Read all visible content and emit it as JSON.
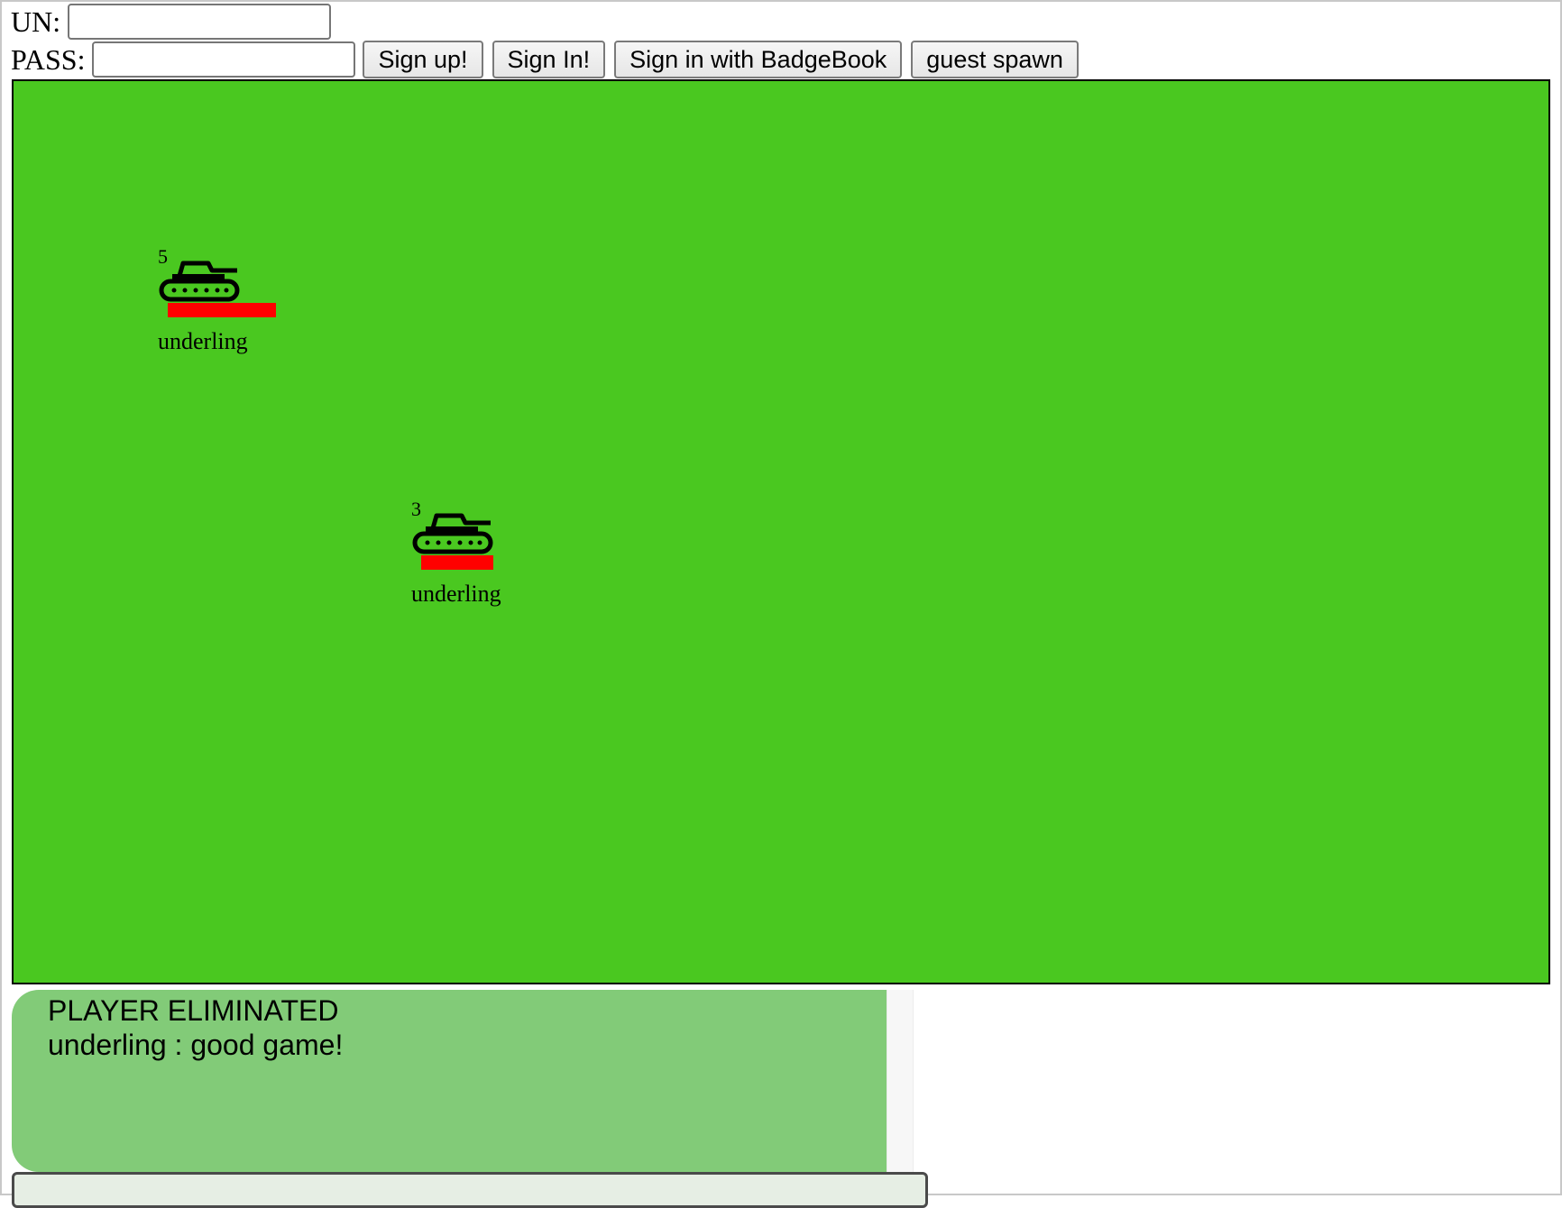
{
  "login": {
    "username_label": "UN:",
    "username_value": "",
    "password_label": "PASS:",
    "password_value": "",
    "buttons": {
      "sign_up": "Sign up!",
      "sign_in": "Sign In!",
      "badgebook": "Sign in with BadgeBook",
      "guest_spawn": "guest spawn"
    }
  },
  "game": {
    "background_color": "#4ac820",
    "tanks": [
      {
        "level": "5",
        "name": "underling",
        "icon": "tank-icon",
        "health_color": "#ff0000"
      },
      {
        "level": "3",
        "name": "underling",
        "icon": "tank-icon",
        "health_color": "#ff0000"
      }
    ]
  },
  "chat": {
    "messages": [
      "PLAYER ELIMINATED",
      "underling : good game!"
    ],
    "input_value": ""
  }
}
